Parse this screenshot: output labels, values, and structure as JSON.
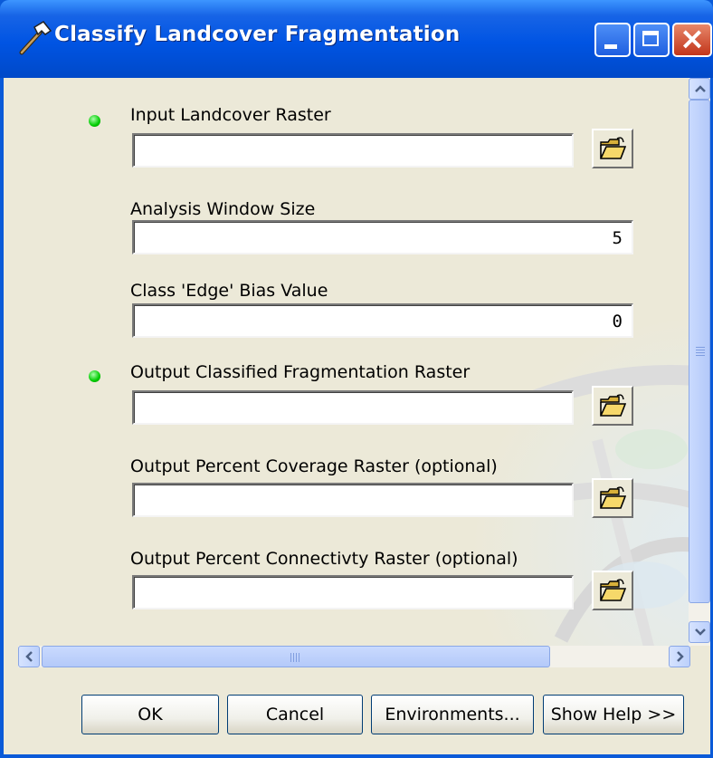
{
  "window": {
    "title": "Classify Landcover Fragmentation",
    "icon": "hammer-icon",
    "controls": [
      "minimize-icon",
      "maximize-icon",
      "close-icon"
    ]
  },
  "fields": [
    {
      "label": "Input Landcover Raster",
      "value": "",
      "required": true,
      "browse": true
    },
    {
      "label": "Analysis Window Size",
      "value": "5",
      "required": false,
      "browse": false
    },
    {
      "label": "Class 'Edge' Bias Value",
      "value": "0",
      "required": false,
      "browse": false
    },
    {
      "label": "Output Classified Fragmentation Raster",
      "value": "",
      "required": true,
      "browse": true
    },
    {
      "label": "Output Percent Coverage Raster (optional)",
      "value": "",
      "required": false,
      "browse": true
    },
    {
      "label": "Output Percent Connectivty Raster (optional)",
      "value": "",
      "required": false,
      "browse": true
    }
  ],
  "buttons": {
    "ok": "OK",
    "cancel": "Cancel",
    "environments": "Environments...",
    "show_help": "Show Help >>"
  },
  "colors": {
    "titlebar": "#0054e3",
    "required_dot": "#00cc00",
    "dialog_bg": "#ece9d8"
  }
}
